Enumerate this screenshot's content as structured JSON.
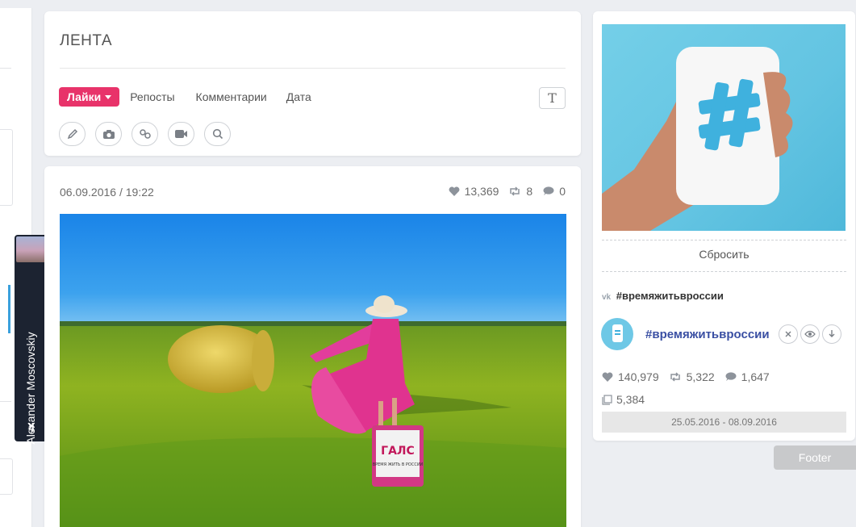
{
  "vk_badge": {
    "user_name": "Alexander Moscovskiy",
    "vk_logo": "vk-logo-icon"
  },
  "feed_header": {
    "title": "ЛЕНТА",
    "sort_tabs": {
      "likes": "Лайки",
      "reposts": "Репосты",
      "comments": "Комментарии",
      "date": "Дата"
    },
    "text_toggle_label": "T",
    "filter_icons": [
      "pencil-icon",
      "camera-icon",
      "link-icon",
      "video-icon",
      "search-icon"
    ]
  },
  "post": {
    "date": "06.09.2016 / 19:22",
    "likes": "13,369",
    "reposts": "8",
    "comments": "0",
    "suitcase_brand": "ГАЛС",
    "suitcase_caption": "ВРЕМЯ ЖИТЬ В РОССИИ"
  },
  "sidebar": {
    "reset_label": "Сбросить",
    "vk_mark": "vk",
    "hashtag": "#времяжитьвроссии",
    "row_title": "#времяжитьвроссии",
    "likes": "140,979",
    "reposts": "5,322",
    "comments": "1,647",
    "posts": "5,384",
    "date_range": "25.05.2016 - 08.09.2016"
  },
  "footer_label": "Footer",
  "colors": {
    "accent": "#e8336a",
    "link": "#3a4fa3",
    "vk_dark": "#1c2331",
    "sky": "#63c4e2"
  }
}
